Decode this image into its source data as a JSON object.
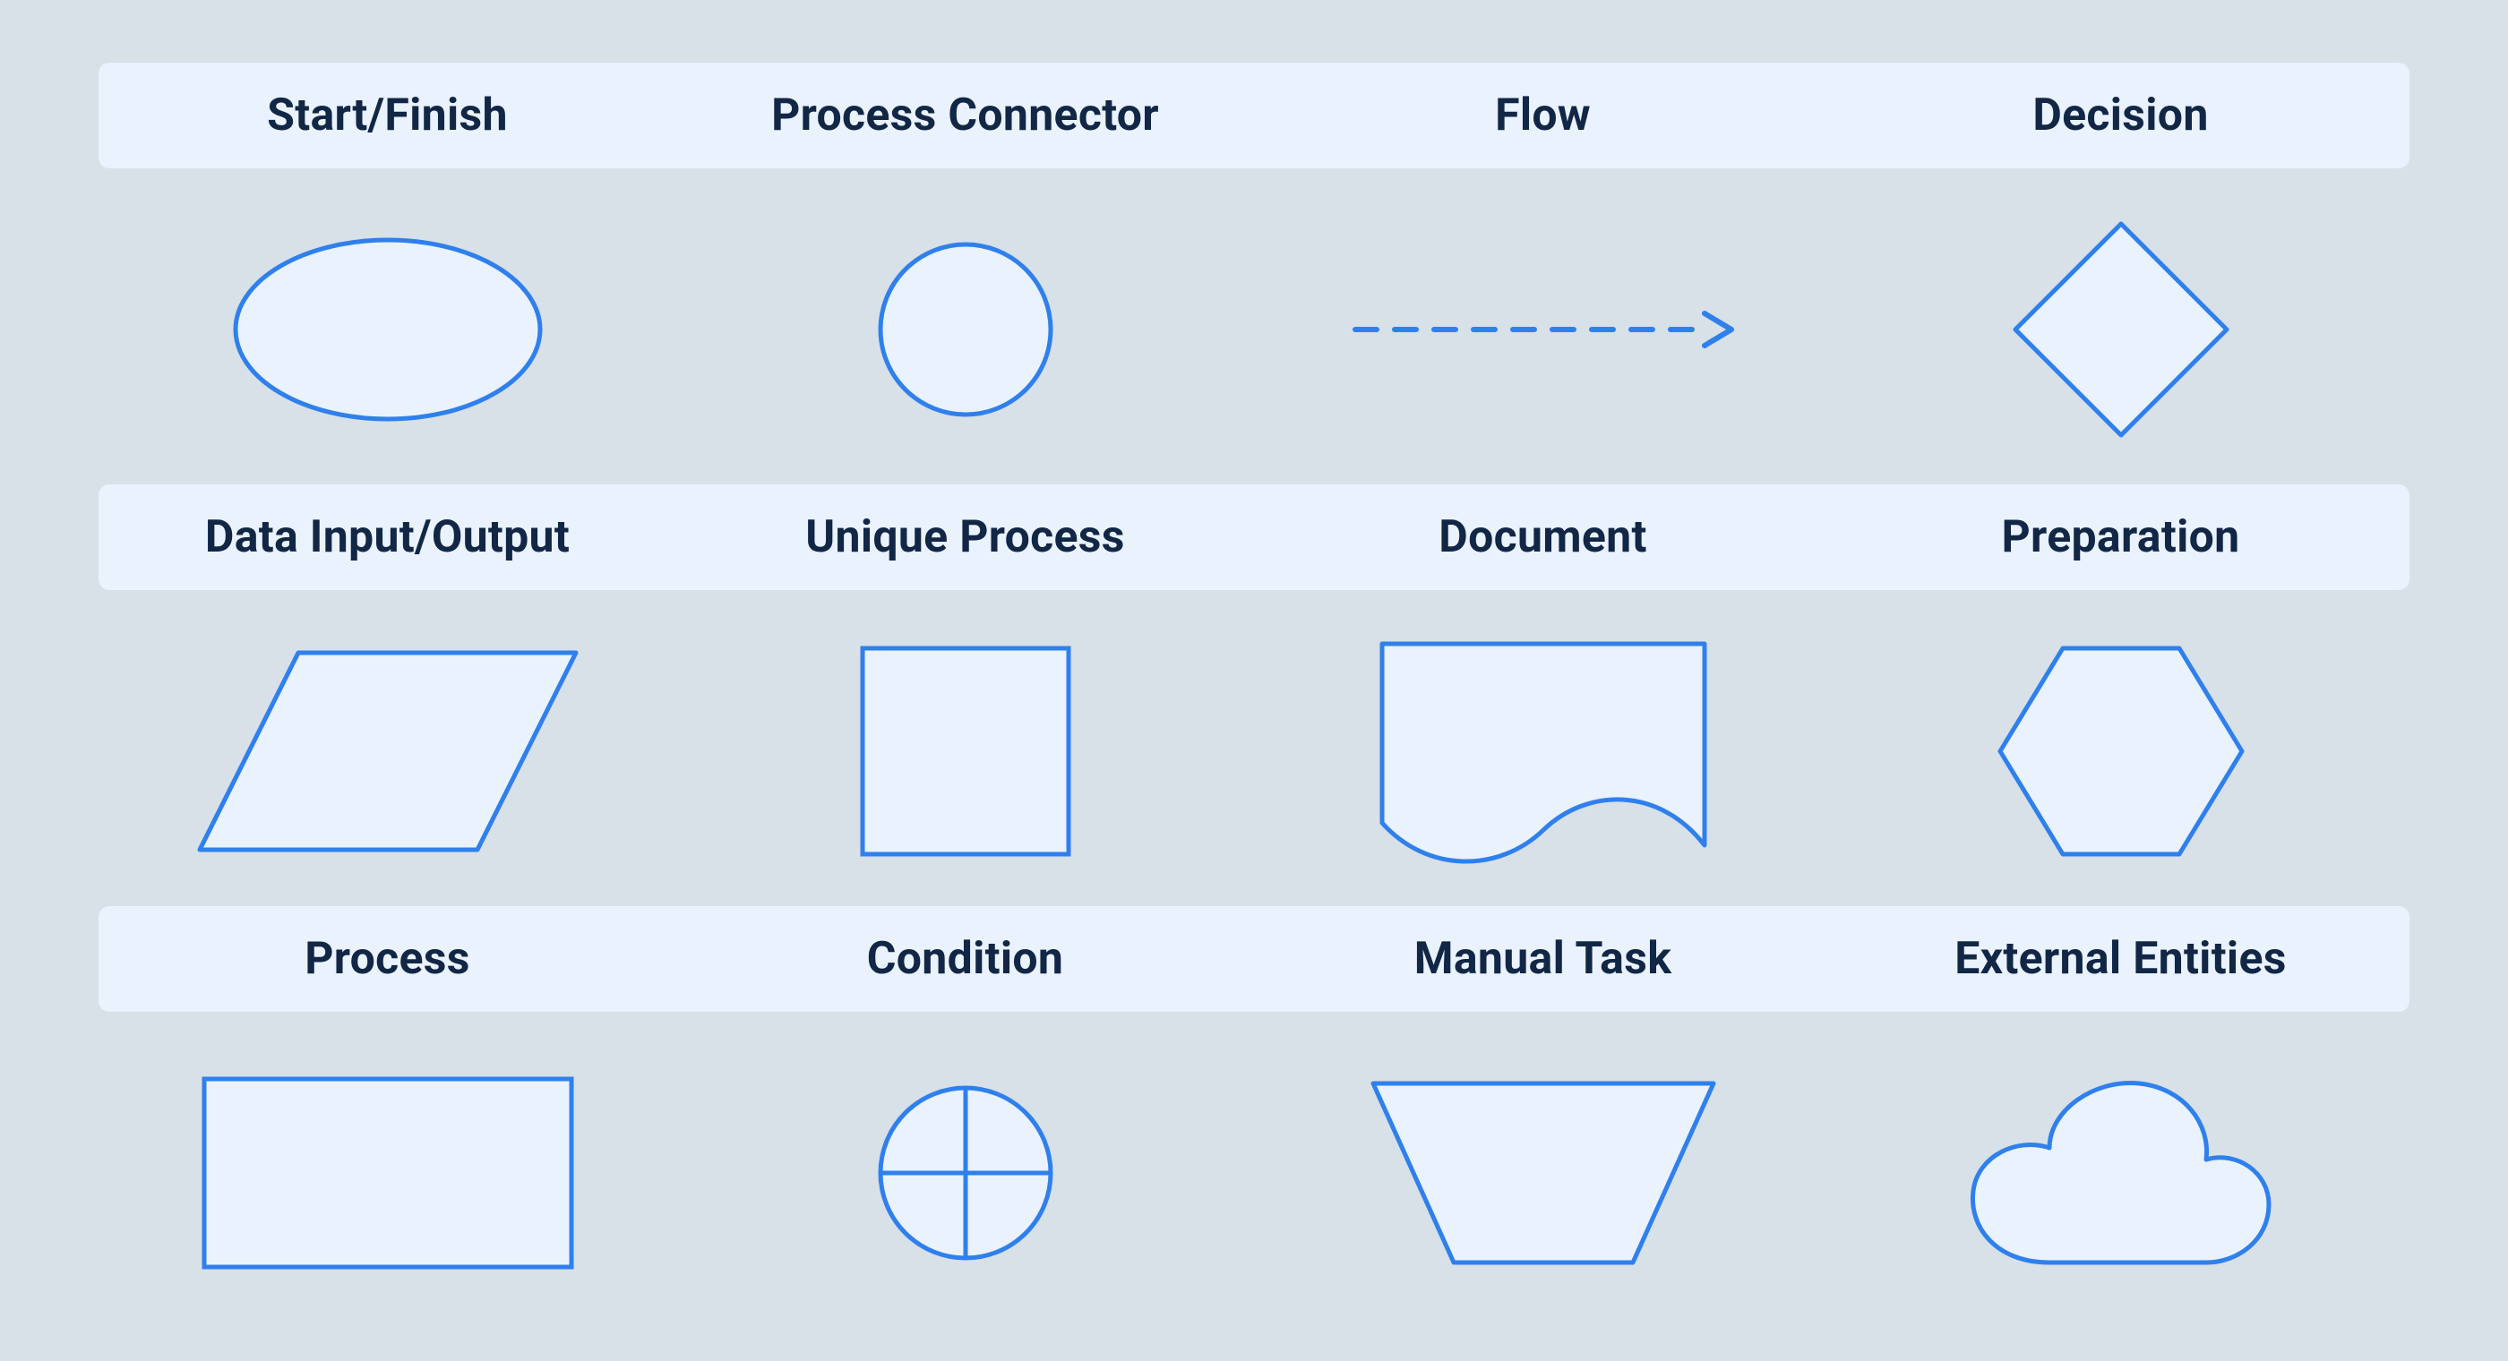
{
  "colors": {
    "background": "#d8e0e8",
    "header_bg": "#e9f2fd",
    "header_text": "#122645",
    "shape_stroke": "#2f80ed",
    "shape_fill": "#e9f2fd"
  },
  "rows": [
    {
      "labels": [
        "Start/Finish",
        "Process Connector",
        "Flow",
        "Decision"
      ],
      "shapes": [
        "ellipse",
        "circle",
        "dashed-arrow",
        "diamond"
      ]
    },
    {
      "labels": [
        "Data Input/Output",
        "Unique Process",
        "Document",
        "Preparation"
      ],
      "shapes": [
        "parallelogram",
        "square",
        "document",
        "hexagon"
      ]
    },
    {
      "labels": [
        "Process",
        "Condition",
        "Manual Task",
        "External Entities"
      ],
      "shapes": [
        "rectangle",
        "crossed-circle",
        "trapezoid",
        "cloud"
      ]
    }
  ]
}
